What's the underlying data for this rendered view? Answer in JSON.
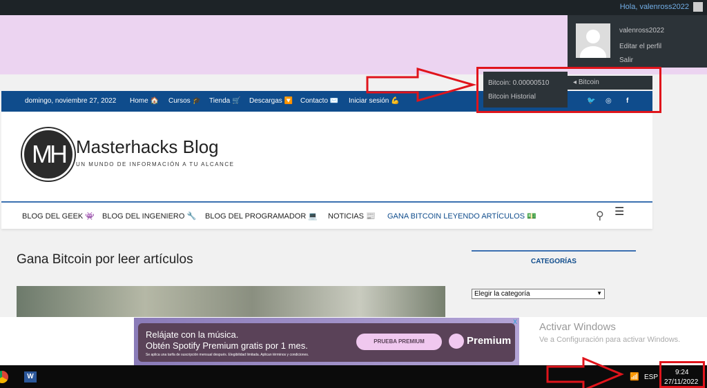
{
  "adminbar": {
    "greeting": "Hola, valenross2022"
  },
  "profile_menu": {
    "username": "valenross2022",
    "edit_profile": "Editar el perfil",
    "logout": "Salir"
  },
  "bitcoin_menu": {
    "label": "Bitcoin",
    "submenu": [
      "Bitcoin: 0.00000510",
      "Bitcoin Historial"
    ]
  },
  "topbar": {
    "date": "domingo, noviembre 27, 2022",
    "links": [
      "Home 🏠",
      "Cursos 🎓",
      "Tienda 🛒",
      "Descargas 🔽",
      "Contacto ✉️",
      "Iniciar sesión 💪"
    ],
    "social": [
      "twitter-icon",
      "instagram-icon",
      "facebook-icon"
    ]
  },
  "site": {
    "logo_text": "MH",
    "name": "Masterhacks Blog",
    "tagline": "UN MUNDO DE INFORMACIÓN A TU ALCANCE"
  },
  "nav": {
    "items": [
      "BLOG DEL GEEK 👾",
      "BLOG DEL INGENIERO 🔧",
      "BLOG DEL PROGRAMADOR 💻",
      "NOTICIAS 📰",
      "GANA BITCOIN LEYENDO ARTÍCULOS 💵"
    ],
    "active_index": 4
  },
  "main": {
    "title": "Gana Bitcoin por leer artículos"
  },
  "sidebar": {
    "heading": "CATEGORÍAS",
    "select_value": "Elegir la categoría"
  },
  "ad": {
    "line1": "Relájate con la música.",
    "line2": "Obtén Spotify Premium gratis por 1 mes.",
    "fine_print": "Se aplica una tarifa de suscripción mensual después. Elegibilidad limitada. Aplican términos y condiciones.",
    "button": "PRUEBA PREMIUM",
    "brand": "Premium",
    "close": "X"
  },
  "watermark": {
    "title": "Activar Windows",
    "subtitle": "Ve a Configuración para activar Windows."
  },
  "taskbar": {
    "lang": "ESP",
    "time": "9:24",
    "date": "27/11/2022"
  },
  "colors": {
    "accent_blue": "#0f4c8c",
    "highlight_red": "#e0141b",
    "admin_bar": "#1d2327"
  }
}
